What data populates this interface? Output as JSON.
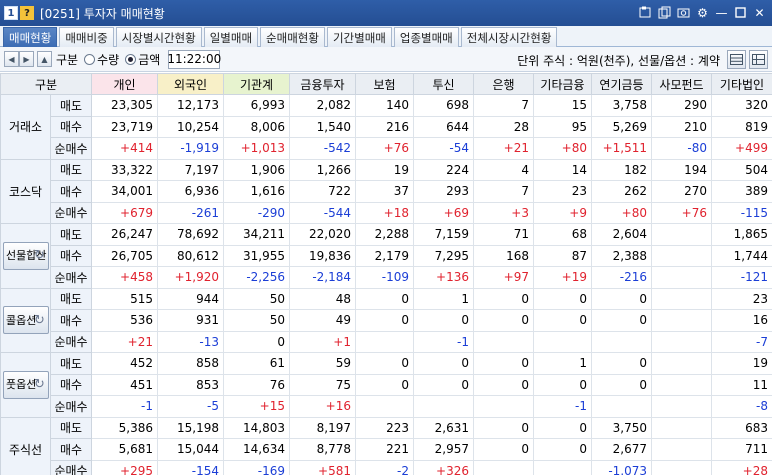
{
  "window": {
    "badge": "1",
    "help": "?",
    "title": "[0251] 투자자 매매현황"
  },
  "tabs": [
    {
      "label": "매매현황",
      "active": true
    },
    {
      "label": "매매비중"
    },
    {
      "label": "시장별시간현황"
    },
    {
      "label": "일별매매"
    },
    {
      "label": "순매매현황"
    },
    {
      "label": "기간별매매"
    },
    {
      "label": "업종별매매"
    },
    {
      "label": "전체시장시간현황"
    }
  ],
  "toolbar": {
    "gubun_label": "구분",
    "radio_qty": "수량",
    "radio_amt": "금액",
    "time": "11:22:00",
    "unit": "단위 주식 : 억원(천주), 선물/옵션 : 계약"
  },
  "table": {
    "headers": [
      "구분",
      "개인",
      "외국인",
      "기관계",
      "금융투자",
      "보험",
      "투신",
      "은행",
      "기타금융",
      "연기금등",
      "사모펀드",
      "기타법인"
    ],
    "row_labels": [
      "매도",
      "매수",
      "순매수"
    ],
    "groups": [
      {
        "name": "거래소",
        "button": false,
        "rows": [
          [
            "23,305",
            "12,173",
            "6,993",
            "2,082",
            "140",
            "698",
            "7",
            "15",
            "3,758",
            "290",
            "320"
          ],
          [
            "23,719",
            "10,254",
            "8,006",
            "1,540",
            "216",
            "644",
            "28",
            "95",
            "5,269",
            "210",
            "819"
          ],
          [
            "+414",
            "-1,919",
            "+1,013",
            "-542",
            "+76",
            "-54",
            "+21",
            "+80",
            "+1,511",
            "-80",
            "+499"
          ]
        ]
      },
      {
        "name": "코스닥",
        "button": false,
        "rows": [
          [
            "33,322",
            "7,197",
            "1,906",
            "1,266",
            "19",
            "224",
            "4",
            "14",
            "182",
            "194",
            "504"
          ],
          [
            "34,001",
            "6,936",
            "1,616",
            "722",
            "37",
            "293",
            "7",
            "23",
            "262",
            "270",
            "389"
          ],
          [
            "+679",
            "-261",
            "-290",
            "-544",
            "+18",
            "+69",
            "+3",
            "+9",
            "+80",
            "+76",
            "-115"
          ]
        ]
      },
      {
        "name": "선물합산",
        "button": true,
        "rows": [
          [
            "26,247",
            "78,692",
            "34,211",
            "22,020",
            "2,288",
            "7,159",
            "71",
            "68",
            "2,604",
            "",
            "1,865"
          ],
          [
            "26,705",
            "80,612",
            "31,955",
            "19,836",
            "2,179",
            "7,295",
            "168",
            "87",
            "2,388",
            "",
            "1,744"
          ],
          [
            "+458",
            "+1,920",
            "-2,256",
            "-2,184",
            "-109",
            "+136",
            "+97",
            "+19",
            "-216",
            "",
            "-121"
          ]
        ]
      },
      {
        "name": "콜옵션",
        "button": true,
        "rows": [
          [
            "515",
            "944",
            "50",
            "48",
            "0",
            "1",
            "0",
            "0",
            "0",
            "",
            "23"
          ],
          [
            "536",
            "931",
            "50",
            "49",
            "0",
            "0",
            "0",
            "0",
            "0",
            "",
            "16"
          ],
          [
            "+21",
            "-13",
            "0",
            "+1",
            "",
            "-1",
            "",
            "",
            "",
            "",
            "-7"
          ]
        ]
      },
      {
        "name": "풋옵션",
        "button": true,
        "rows": [
          [
            "452",
            "858",
            "61",
            "59",
            "0",
            "0",
            "0",
            "1",
            "0",
            "",
            "19"
          ],
          [
            "451",
            "853",
            "76",
            "75",
            "0",
            "0",
            "0",
            "0",
            "0",
            "",
            "11"
          ],
          [
            "-1",
            "-5",
            "+15",
            "+16",
            "",
            "",
            "",
            "-1",
            "",
            "",
            "-8"
          ]
        ]
      },
      {
        "name": "주식선",
        "button": false,
        "rows": [
          [
            "5,386",
            "15,198",
            "14,803",
            "8,197",
            "223",
            "2,631",
            "0",
            "0",
            "3,750",
            "",
            "683"
          ],
          [
            "5,681",
            "15,044",
            "14,634",
            "8,778",
            "221",
            "2,957",
            "0",
            "0",
            "2,677",
            "",
            "711"
          ],
          [
            "+295",
            "-154",
            "-169",
            "+581",
            "-2",
            "+326",
            "",
            "",
            "-1,073",
            "",
            "+28"
          ]
        ]
      }
    ]
  },
  "colors": {
    "positive": "#e0222e",
    "negative": "#1b3ed6",
    "title_bar": "#2f5ea8",
    "active_tab": "#3c6cb4"
  }
}
